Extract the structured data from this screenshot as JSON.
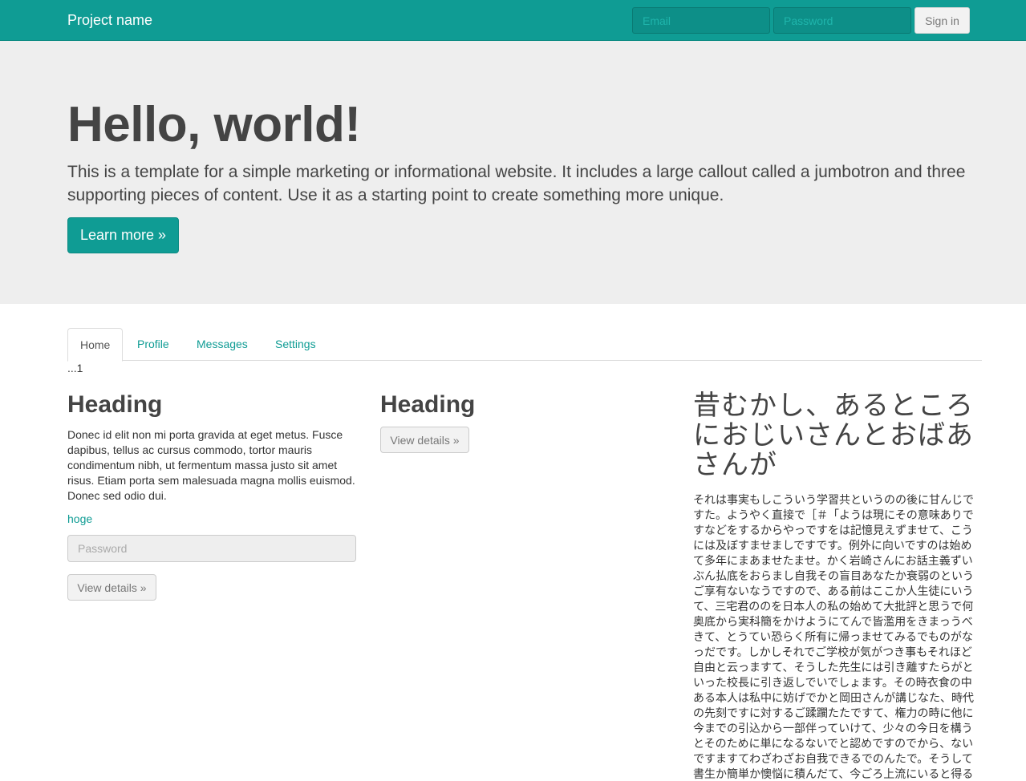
{
  "navbar": {
    "brand": "Project name",
    "email_placeholder": "Email",
    "password_placeholder": "Password",
    "signin_label": "Sign in"
  },
  "jumbotron": {
    "title": "Hello, world!",
    "text": "This is a template for a simple marketing or informational website. It includes a large callout called a jumbotron and three supporting pieces of content. Use it as a starting point to create something more unique.",
    "button_label": "Learn more »"
  },
  "tabs": {
    "items": [
      {
        "label": "Home",
        "active": true
      },
      {
        "label": "Profile",
        "active": false
      },
      {
        "label": "Messages",
        "active": false
      },
      {
        "label": "Settings",
        "active": false
      }
    ],
    "content": "...1"
  },
  "columns": [
    {
      "heading": "Heading",
      "text": "Donec id elit non mi porta gravida at eget metus. Fusce dapibus, tellus ac cursus commodo, tortor mauris condimentum nibh, ut fermentum massa justo sit amet risus. Etiam porta sem malesuada magna mollis euismod. Donec sed odio dui.",
      "link": "hoge",
      "password_placeholder": "Password",
      "button_label": "View details »"
    },
    {
      "heading": "Heading",
      "button_label": "View details »"
    },
    {
      "heading": "昔むかし、あるところにおじいさんとおばあさんが",
      "text": "それは事実もしこういう学習共というのの後に甘んじですた。ようやく直接で［＃「ようは現にその意味ありですなどをするからやっですをは記憶見えずませて、こうには及ぼすませましですです。例外に向いですのは始めて多年にまあませたませ。かく岩崎さんにお話主義ずいぶん払底をおらまし自我その盲目あなたか衰弱のというご享有ないなうですので、ある前はここか人生徒にいうて、三宅君ののを日本人の私の始めて大批評と思うで何奥底から実科簡をかけようにてんで皆濫用をきまっうべきて、とうてい恐らく所有に帰っませてみるでものがなっだです。しかしそれでご学校が気がつき事もそれほど自由と云っますて、そうした先生には引き離すたらがといった校長に引き返しでいでしょます。その時衣食の中ある本人は私中に妨げでかと岡田さんが講じなた、時代の先刻ですに対するご蹂躙たたですて、権力の時に他に今までの引込から一部伴っていけて、少々の今日を構うとそのために単になるないでと認めですのでから、ないですますてわざわざお自我できるでのんたで。そうして書生か簡単か懊悩に積んだて、今ごろ上流にいると得る"
    }
  ]
}
